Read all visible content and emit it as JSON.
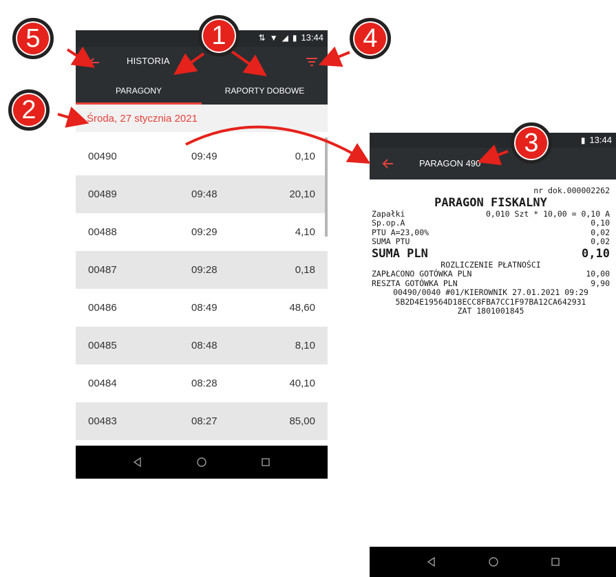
{
  "phone1": {
    "status_time": "13:44",
    "appbar_title": "HISTORIA",
    "tabs": [
      "PARAGONY",
      "RAPORTY DOBOWE"
    ],
    "date_header": "Środa, 27 stycznia 2021",
    "rows": [
      {
        "number": "00490",
        "time": "09:49",
        "amount": "0,10"
      },
      {
        "number": "00489",
        "time": "09:48",
        "amount": "20,10"
      },
      {
        "number": "00488",
        "time": "09:29",
        "amount": "4,10"
      },
      {
        "number": "00487",
        "time": "09:28",
        "amount": "0,18"
      },
      {
        "number": "00486",
        "time": "08:49",
        "amount": "48,60"
      },
      {
        "number": "00485",
        "time": "08:48",
        "amount": "8,10"
      },
      {
        "number": "00484",
        "time": "08:28",
        "amount": "40,10"
      },
      {
        "number": "00483",
        "time": "08:27",
        "amount": "85,00"
      }
    ]
  },
  "phone2": {
    "status_time": "13:44",
    "appbar_title": "PARAGON 490",
    "receipt": {
      "doc_number": "nr dok.000002262",
      "title": "PARAGON FISKALNY",
      "item_name": "Zapałki",
      "item_detail": "0,010 Szt * 10,00 = 0,10 A",
      "sp_label": "Sp.op.A",
      "sp_value": "0,10",
      "ptu_label": "PTU A=23,00%",
      "ptu_value": "0,02",
      "suma_ptu_label": "SUMA PTU",
      "suma_ptu_value": "0,02",
      "suma_label": "SUMA PLN",
      "suma_value": "0,10",
      "settlement_header": "ROZLICZENIE PŁATNOŚCI",
      "paid_label": "ZAPŁACONO GOTÓWKA PLN",
      "paid_value": "10,00",
      "change_label": "RESZTA GOTÓWKA PLN",
      "change_value": "9,90",
      "footer_line": "00490/0040 #01/KIEROWNIK  27.01.2021 09:29",
      "hash": "5B2D4E19564D18ECC8FBA7CC1F97BA12CA642931",
      "zat": "ZAT 1801001845"
    }
  },
  "callouts": [
    "1",
    "2",
    "3",
    "4",
    "5"
  ],
  "colors": {
    "accent": "#e5413a",
    "bar": "#2b2f32",
    "callout": "#e5221b"
  }
}
